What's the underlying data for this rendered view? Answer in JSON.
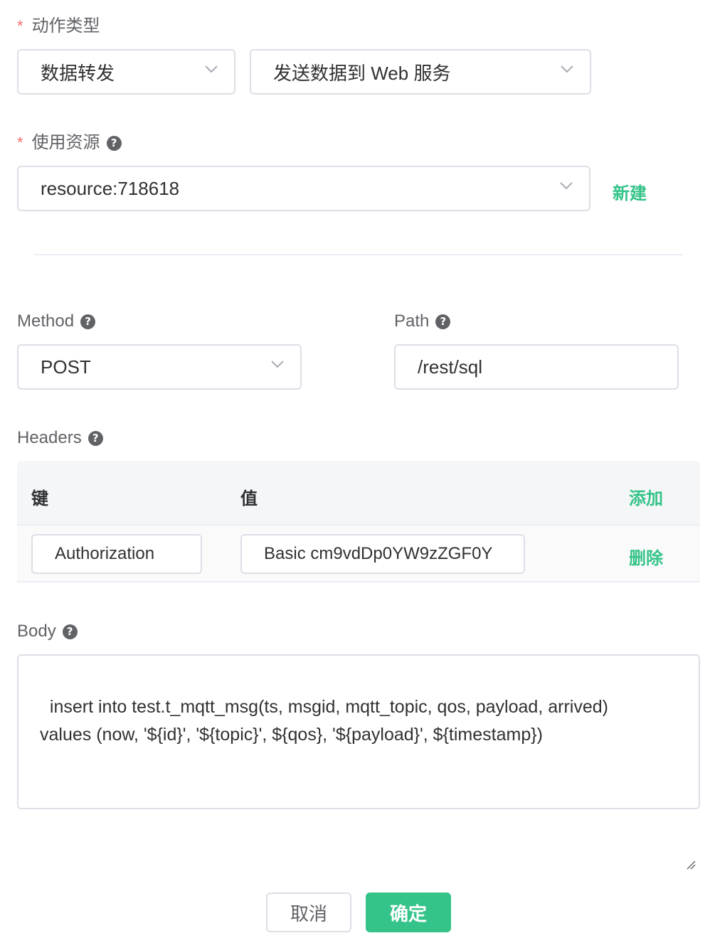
{
  "action_type": {
    "required_mark": "*",
    "label": "动作类型",
    "category_value": "数据转发",
    "action_value": "发送数据到 Web 服务"
  },
  "resource": {
    "required_mark": "*",
    "label": "使用资源",
    "help_icon": "?",
    "value": "resource:718618",
    "new_link": "新建"
  },
  "method": {
    "label": "Method",
    "help_icon": "?",
    "value": "POST"
  },
  "path": {
    "label": "Path",
    "help_icon": "?",
    "value": "/rest/sql"
  },
  "headers": {
    "label": "Headers",
    "help_icon": "?",
    "col_key": "键",
    "col_value": "值",
    "add_link": "添加",
    "rows": [
      {
        "key": "Authorization",
        "value": "Basic cm9vdDp0YW9zZGF0Y",
        "delete_link": "删除"
      }
    ]
  },
  "body": {
    "label": "Body",
    "help_icon": "?",
    "value": "insert into test.t_mqtt_msg(ts, msgid, mqtt_topic, qos, payload, arrived)\nvalues (now, '${id}', '${topic}', ${qos}, '${payload}', ${timestamp})"
  },
  "footer": {
    "cancel_label": "取消",
    "confirm_label": "确定"
  },
  "colors": {
    "primary": "#34c388",
    "required": "#f56c6c",
    "border": "#dcdfe6"
  },
  "icons": {
    "dropdown": "chevron-down-icon",
    "help": "question-circle-icon",
    "resize": "resize-handle-icon"
  }
}
